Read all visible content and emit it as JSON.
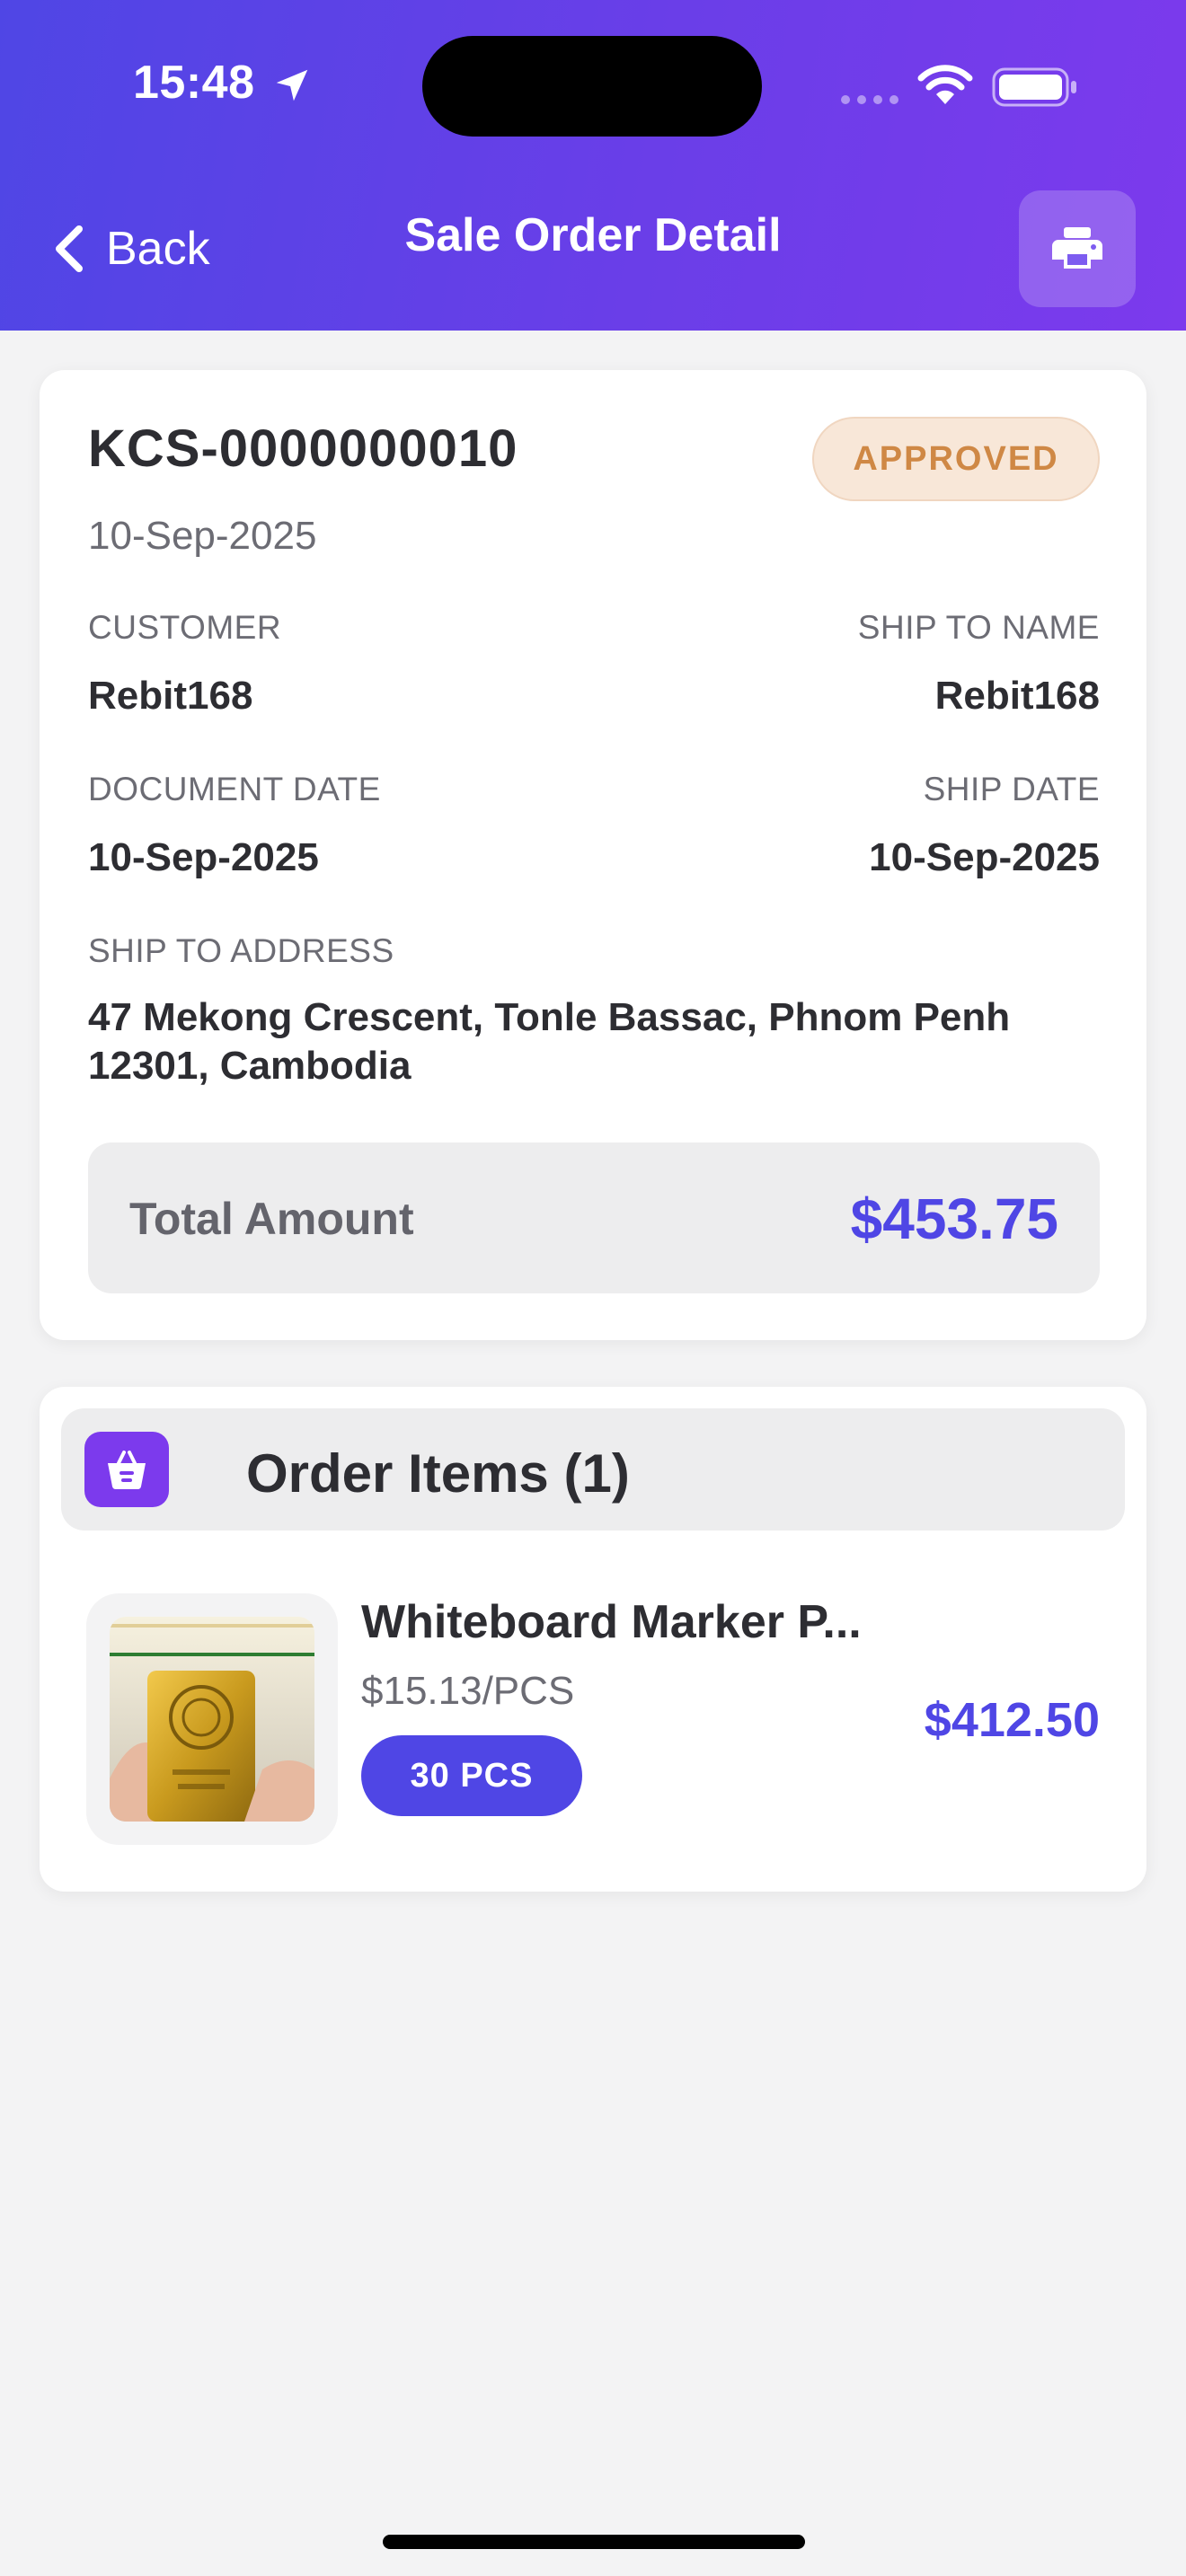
{
  "status_bar": {
    "time": "15:48",
    "icons": [
      "location-arrow-icon",
      "cellular-signal-icon",
      "wifi-icon",
      "battery-icon"
    ]
  },
  "nav": {
    "back_label": "Back",
    "title": "Sale Order Detail",
    "print_icon": "printer-icon"
  },
  "order": {
    "number": "KCS-0000000010",
    "date": "10-Sep-2025",
    "status": "APPROVED",
    "customer_label": "CUSTOMER",
    "customer": "Rebit168",
    "ship_to_name_label": "SHIP TO NAME",
    "ship_to_name": "Rebit168",
    "document_date_label": "DOCUMENT DATE",
    "document_date": "10-Sep-2025",
    "ship_date_label": "SHIP DATE",
    "ship_date": "10-Sep-2025",
    "ship_to_address_label": "SHIP TO ADDRESS",
    "ship_to_address": "47 Mekong Crescent, Tonle Bassac, Phnom Penh 12301, Cambodia",
    "total_label": "Total Amount",
    "total": "$453.75"
  },
  "items_section": {
    "title": "Order Items (1)",
    "icon": "shopping-basket-icon",
    "items": [
      {
        "name": "Whiteboard Marker P...",
        "unit_price": "$15.13/PCS",
        "quantity": "30 PCS",
        "line_total": "$412.50"
      }
    ]
  },
  "colors": {
    "header_gradient_start": "#4f46e5",
    "header_gradient_end": "#7c3aed",
    "accent": "#4f46e5",
    "status_badge_bg": "#f8e7d8",
    "status_badge_text": "#cf8845"
  }
}
